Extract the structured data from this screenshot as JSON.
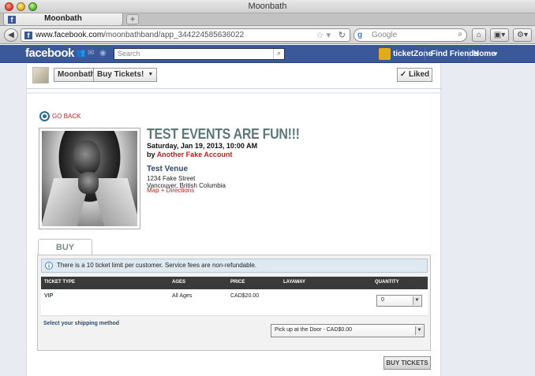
{
  "window": {
    "title": "Moonbath"
  },
  "tabs": [
    {
      "label": "Moonbath"
    }
  ],
  "browser": {
    "url_host": "www.facebook.com",
    "url_path": "/moonbathband/app_344224585636022",
    "search_placeholder": "Google"
  },
  "facebook": {
    "logo": "facebook",
    "search_placeholder": "Search",
    "app_name": "ticketZone",
    "nav": [
      "Find Friends",
      "Home"
    ]
  },
  "app_bar": {
    "page_name": "Moonbath",
    "tab_label": "Buy Tickets!",
    "liked_label": "Liked"
  },
  "event": {
    "go_back": "GO BACK",
    "title": "TEST EVENTS ARE FUN!!!",
    "date": "Saturday, Jan 19, 2013, 10:00 AM",
    "by_prefix": "by",
    "organizer": "Another Fake Account",
    "venue_name": "Test Venue",
    "venue_address": [
      "1234 Fake Street",
      "Vancouver, British Columbia"
    ],
    "map_link": "Map + Directions"
  },
  "buy_tickets": {
    "section_label": "BUY TICKETS",
    "notice": "There is a 10 ticket limit per customer. Service fees are non-refundable.",
    "columns": [
      "TICKET TYPE",
      "AGES",
      "PRICE",
      "LAYAWAY",
      "QUANTITY"
    ],
    "rows": [
      {
        "type": "VIP",
        "ages": "All Ages",
        "price": "CAD$20.00",
        "layaway": "",
        "quantity": "0"
      }
    ],
    "shipping_label": "Select your shipping method",
    "shipping_value": "Pick up at the Door - CAD$0.00",
    "button_label": "BUY TICKETS"
  },
  "colors": {
    "facebook_blue": "#3b5998",
    "link_red": "#c81e1e",
    "title_teal": "#5c7878"
  }
}
